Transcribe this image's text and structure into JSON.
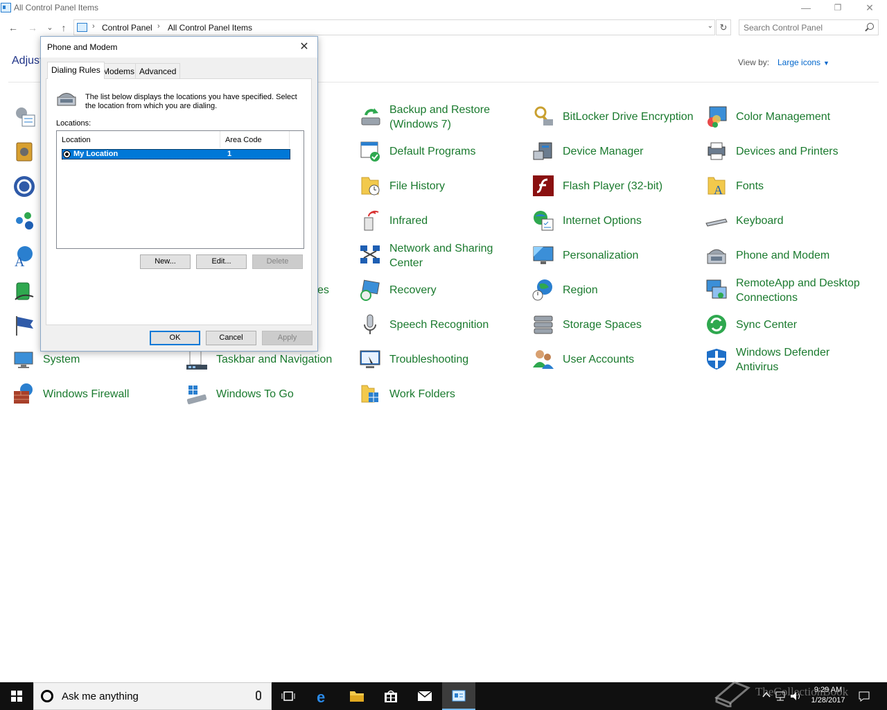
{
  "window": {
    "title": "All Control Panel Items",
    "minimize": "—",
    "restore": "❐",
    "close": "✕"
  },
  "nav": {
    "back": "←",
    "forward": "→",
    "recent": "⌄",
    "up": "↑",
    "breadcrumbs": [
      "Control Panel",
      "All Control Panel Items"
    ],
    "separator": "›",
    "dropdown": "⌄",
    "refresh": "↻",
    "search_placeholder": "Search Control Panel"
  },
  "header": {
    "heading": "Adjust your computer's settings",
    "view_by_label": "View by:",
    "view_by_value": "Large icons",
    "view_by_caret": "▼"
  },
  "items": [
    {
      "label": "Backup and Restore (Windows 7)",
      "icon": "backup-icon"
    },
    {
      "label": "BitLocker Drive Encryption",
      "icon": "bitlocker-icon"
    },
    {
      "label": "Color Management",
      "icon": "color-management-icon"
    },
    {
      "label": "Default Programs",
      "icon": "default-programs-icon"
    },
    {
      "label": "Device Manager",
      "icon": "device-manager-icon"
    },
    {
      "label": "Devices and Printers",
      "icon": "printer-icon"
    },
    {
      "label": "File History",
      "icon": "file-history-icon"
    },
    {
      "label": "Flash Player (32-bit)",
      "icon": "flash-icon"
    },
    {
      "label": "Fonts",
      "icon": "fonts-icon"
    },
    {
      "label": "Infrared",
      "icon": "infrared-icon"
    },
    {
      "label": "Internet Options",
      "icon": "internet-options-icon"
    },
    {
      "label": "Keyboard",
      "icon": "keyboard-icon"
    },
    {
      "label": "Network and Sharing Center",
      "icon": "network-icon"
    },
    {
      "label": "Personalization",
      "icon": "personalization-icon"
    },
    {
      "label": "Phone and Modem",
      "icon": "phone-icon"
    },
    {
      "label": "Recovery",
      "icon": "recovery-icon"
    },
    {
      "label": "Region",
      "icon": "region-icon"
    },
    {
      "label": "RemoteApp and Desktop Connections",
      "icon": "remoteapp-icon"
    },
    {
      "label": "Speech Recognition",
      "icon": "microphone-icon"
    },
    {
      "label": "Storage Spaces",
      "icon": "storage-icon"
    },
    {
      "label": "Sync Center",
      "icon": "sync-icon"
    },
    {
      "label": "System",
      "icon": "system-icon"
    },
    {
      "label": "Taskbar and Navigation",
      "icon": "taskbar-icon"
    },
    {
      "label": "Troubleshooting",
      "icon": "troubleshooting-icon"
    },
    {
      "label": "User Accounts",
      "icon": "user-accounts-icon"
    },
    {
      "label": "Windows Defender Antivirus",
      "icon": "defender-icon"
    },
    {
      "label": "Windows Firewall",
      "icon": "firewall-icon"
    },
    {
      "label": "Windows To Go",
      "icon": "windows-to-go-icon"
    },
    {
      "label": "Work Folders",
      "icon": "work-folders-icon"
    },
    {
      "label": "es",
      "icon": ""
    }
  ],
  "dialog": {
    "title": "Phone and Modem",
    "close": "✕",
    "tabs": [
      "Dialing Rules",
      "Modems",
      "Advanced"
    ],
    "intro": "The list below displays the locations you have specified. Select the location from which you are dialing.",
    "locations_label": "Locations:",
    "columns": [
      "Location",
      "Area Code"
    ],
    "rows": [
      {
        "location": "My Location",
        "area_code": "1"
      }
    ],
    "buttons": {
      "new": "New...",
      "edit": "Edit...",
      "delete": "Delete",
      "ok": "OK",
      "cancel": "Cancel",
      "apply": "Apply"
    }
  },
  "taskbar": {
    "search_placeholder": "Ask me anything",
    "time": "9:29 AM",
    "date": "1/28/2017",
    "watermark": "TheCollectionBook"
  },
  "colors": {
    "link_green": "#1a7a2e",
    "heading_blue": "#1e3287",
    "selection_blue": "#0078d7",
    "taskbar": "#101010"
  }
}
